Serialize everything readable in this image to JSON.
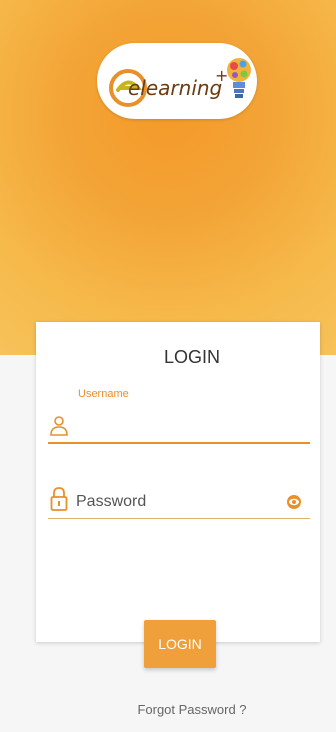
{
  "logo": {
    "text": "elearning",
    "plus": "+"
  },
  "login_card": {
    "title": "LOGIN",
    "username": {
      "label": "Username",
      "value": ""
    },
    "password": {
      "placeholder": "Password",
      "value": ""
    }
  },
  "login_button_label": "LOGIN",
  "forgot_password_label": "Forgot Password ?",
  "colors": {
    "accent": "#e8902a",
    "button": "#f0a03a",
    "hero_top": "#f49a2a",
    "hero_bottom": "#f7c25a"
  },
  "icons": {
    "user": "user-icon",
    "lock": "lock-icon",
    "eye": "eye-icon",
    "bulb": "lightbulb-icon"
  }
}
